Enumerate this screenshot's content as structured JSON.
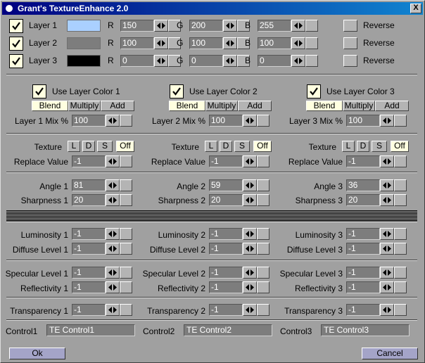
{
  "window": {
    "title": "Grant's TextureEnhance 2.0",
    "close_label": "X"
  },
  "layers": [
    {
      "label": "Layer 1",
      "color": "#aad0ff",
      "r": "150",
      "g": "200",
      "b": "255",
      "reverse": "Reverse"
    },
    {
      "label": "Layer 2",
      "color": "#7d7d7d",
      "r": "100",
      "g": "100",
      "b": "100",
      "reverse": "Reverse"
    },
    {
      "label": "Layer 3",
      "color": "#000000",
      "r": "0",
      "g": "0",
      "b": "0",
      "reverse": "Reverse"
    }
  ],
  "rgb_labels": {
    "r": "R",
    "g": "G",
    "b": "B"
  },
  "groups": [
    {
      "use": "Use Layer Color 1",
      "mix_label": "Layer 1 Mix %",
      "mix": "100",
      "replace": "-1",
      "angle_label": "Angle 1",
      "angle": "81",
      "sharp_label": "Sharpness 1",
      "sharp": "20",
      "lum_label": "Luminosity 1",
      "lum": "-1",
      "diff_label": "Diffuse Level 1",
      "diff": "-1",
      "spec_label": "Specular Level 1",
      "spec": "-1",
      "refl_label": "Reflectivity 1",
      "refl": "-1",
      "trans_label": "Transparency 1",
      "trans": "-1",
      "control_label": "Control1",
      "control": "TE Control1"
    },
    {
      "use": "Use Layer Color 2",
      "mix_label": "Layer 2 Mix %",
      "mix": "100",
      "replace": "-1",
      "angle_label": "Angle 2",
      "angle": "59",
      "sharp_label": "Sharpness 2",
      "sharp": "20",
      "lum_label": "Luminosity 2",
      "lum": "-1",
      "diff_label": "Diffuse Level 2",
      "diff": "-1",
      "spec_label": "Specular Level 2",
      "spec": "-1",
      "refl_label": "Reflectivity 2",
      "refl": "-1",
      "trans_label": "Transparency 2",
      "trans": "-1",
      "control_label": "Control2",
      "control": "TE Control2"
    },
    {
      "use": "Use Layer Color 3",
      "mix_label": "Layer 3 Mix %",
      "mix": "100",
      "replace": "-1",
      "angle_label": "Angle 3",
      "angle": "36",
      "sharp_label": "Sharpness 3",
      "sharp": "20",
      "lum_label": "Luminosity 3",
      "lum": "-1",
      "diff_label": "Diffuse Level 3",
      "diff": "-1",
      "spec_label": "Specular Level 3",
      "spec": "-1",
      "refl_label": "Reflectivity 3",
      "refl": "-1",
      "trans_label": "Transparency 3",
      "trans": "-1",
      "control_label": "Control3",
      "control": "TE Control3"
    }
  ],
  "blend_modes": [
    "Blend",
    "Multiply",
    "Add"
  ],
  "blend_selected": "Blend",
  "texture_label": "Texture",
  "texture_options": [
    "L",
    "D",
    "S",
    "Off"
  ],
  "texture_selected": "Off",
  "replace_label": "Replace Value",
  "buttons": {
    "ok": "Ok",
    "cancel": "Cancel"
  },
  "icons": {
    "check": "check-icon",
    "spin": "spinner-arrows-icon",
    "app": "app-icon",
    "close": "close-icon"
  }
}
